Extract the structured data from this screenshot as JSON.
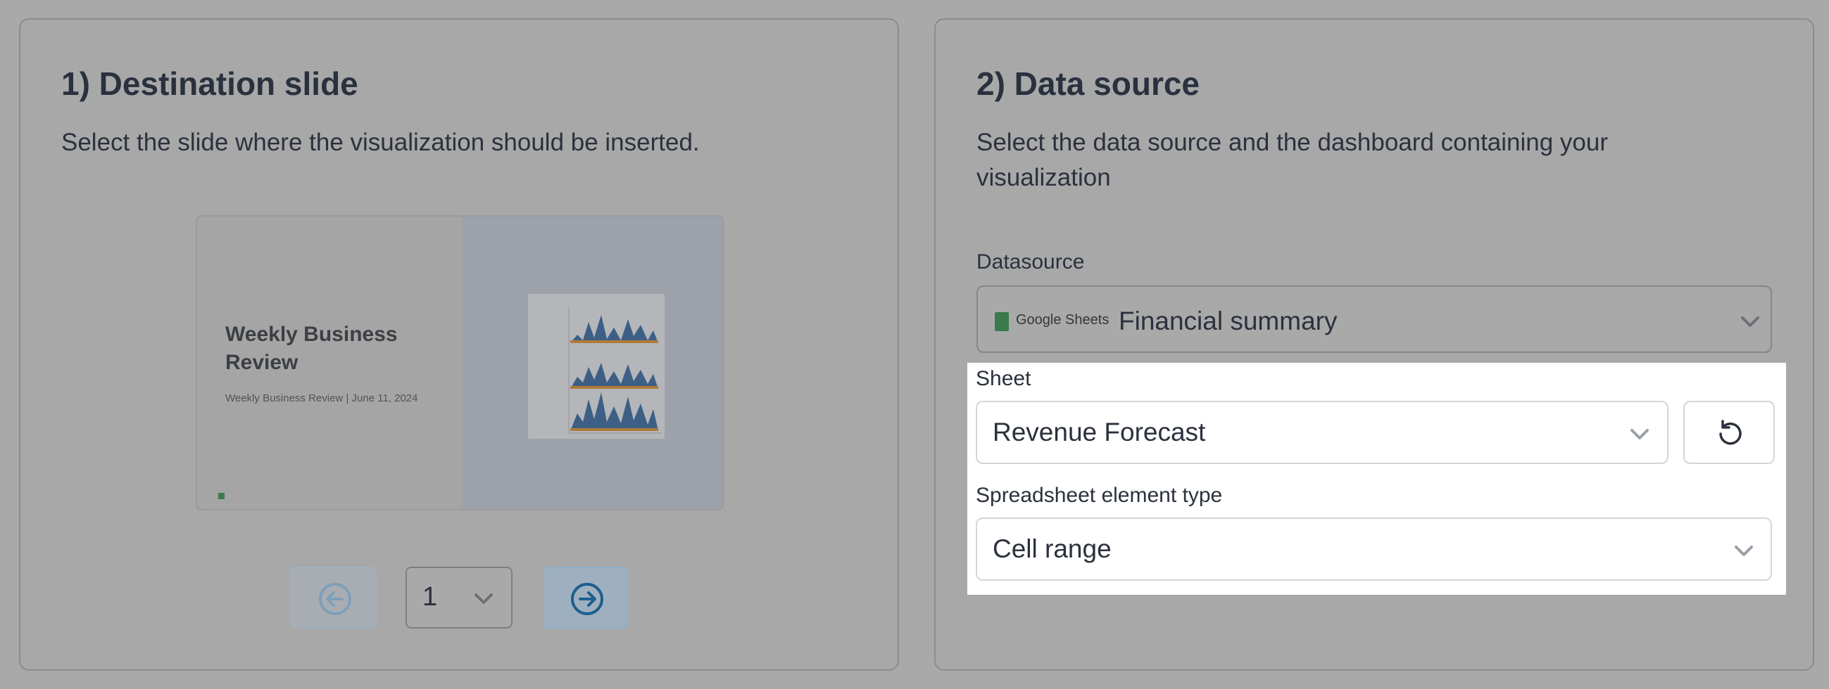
{
  "destination": {
    "title": "1) Destination slide",
    "description": "Select the slide where the visualization should be inserted.",
    "slide_preview": {
      "title": "Weekly Business Review",
      "subtitle": "Weekly Business Review | June 11, 2024"
    },
    "pager": {
      "current_page": "1",
      "prev_icon": "arrow-left-circle-icon",
      "next_icon": "arrow-right-circle-icon"
    }
  },
  "datasource_section": {
    "title": "2) Data source",
    "description_line1": "Select the data source and the dashboard containing your",
    "description_line2": "visualization",
    "datasource_label": "Datasource",
    "datasource_brand": "Google Sheets",
    "datasource_value": "Financial summary",
    "sheet_label": "Sheet",
    "sheet_value": "Revenue Forecast",
    "element_type_label": "Spreadsheet element type",
    "element_type_value": "Cell range"
  },
  "colors": {
    "overlay": "#a9a9a9",
    "highlight": "#ffffff",
    "text": "#2b313d",
    "google_sheets": "#3b7a4b",
    "accent_blue": "#1c6fa8"
  }
}
